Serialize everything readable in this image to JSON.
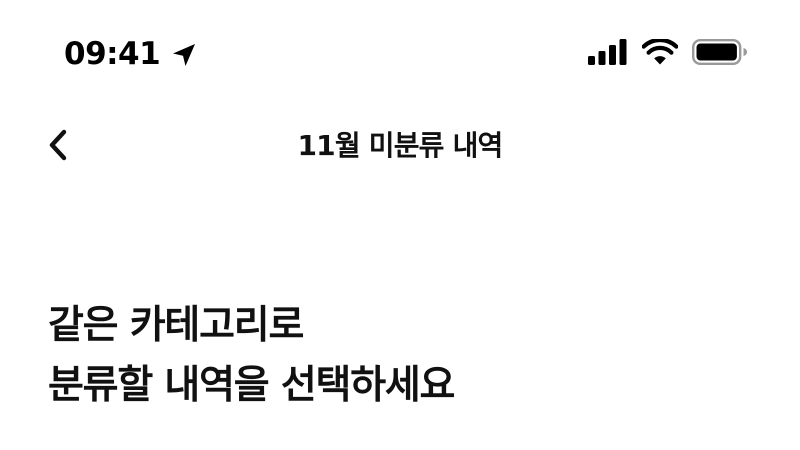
{
  "status_bar": {
    "time": "09:41",
    "icons": {
      "location": "location-arrow-icon",
      "signal": "cellular-signal-icon",
      "wifi": "wifi-icon",
      "battery": "battery-icon"
    }
  },
  "nav": {
    "title": "11월 미분류 내역",
    "back_icon": "chevron-left-icon"
  },
  "heading": {
    "line1": "같은 카테고리로",
    "line2": "분류할 내역을 선택하세요"
  },
  "colors": {
    "background": "#ffffff",
    "text": "#111111"
  }
}
